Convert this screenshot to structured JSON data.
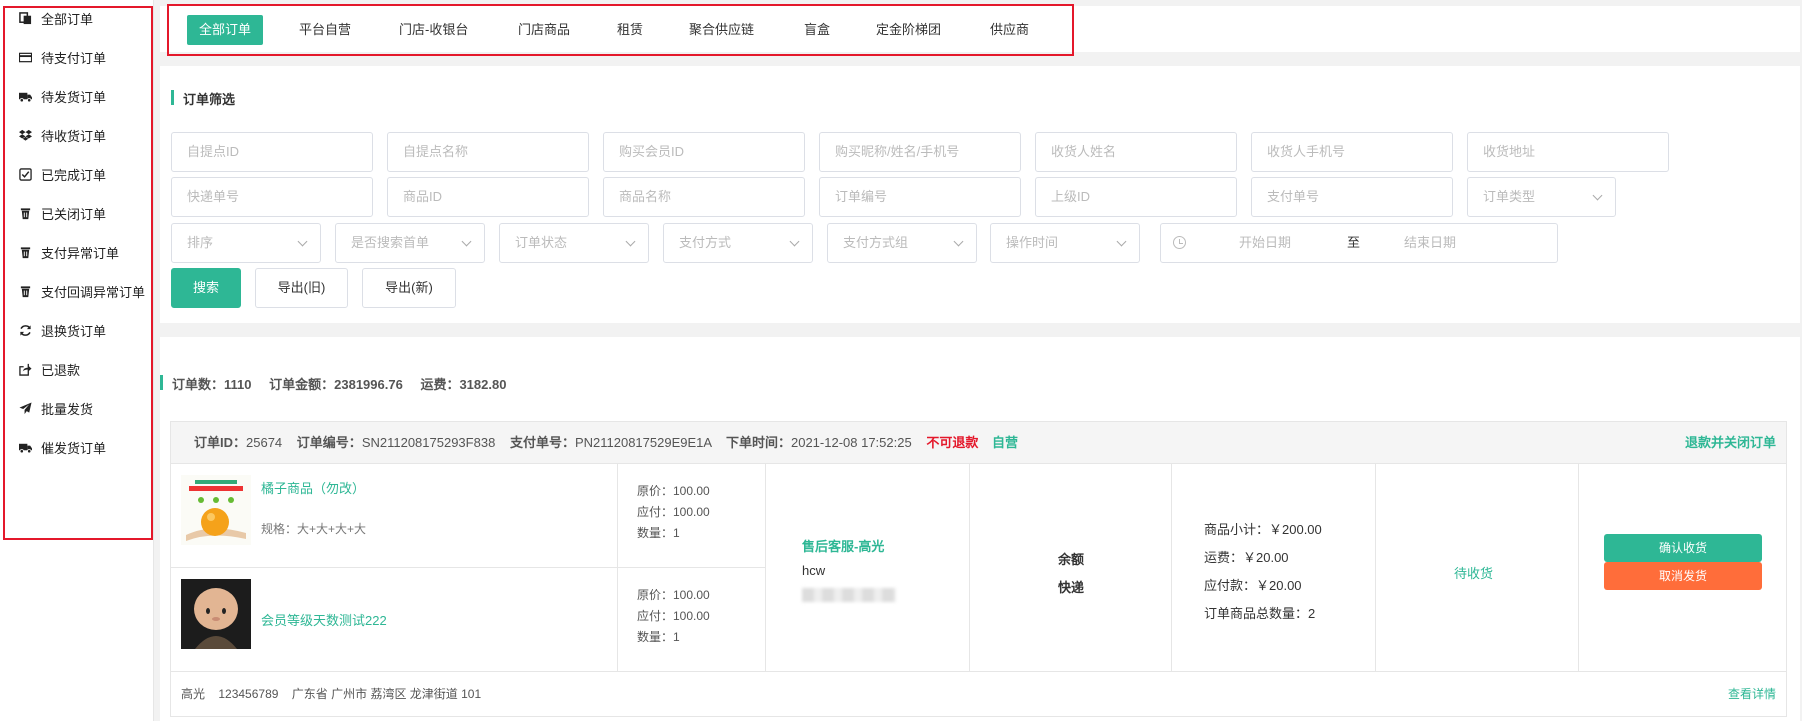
{
  "sidebar": {
    "items": [
      {
        "label": "全部订单",
        "icon": "copy-icon"
      },
      {
        "label": "待支付订单",
        "icon": "credit-card-icon"
      },
      {
        "label": "待发货订单",
        "icon": "truck-icon"
      },
      {
        "label": "待收货订单",
        "icon": "dropbox-icon"
      },
      {
        "label": "已完成订单",
        "icon": "check-square-icon"
      },
      {
        "label": "已关闭订单",
        "icon": "trash-icon"
      },
      {
        "label": "支付异常订单",
        "icon": "trash-icon"
      },
      {
        "label": "支付回调异常订单",
        "icon": "trash-icon"
      },
      {
        "label": "退换货订单",
        "icon": "refresh-icon"
      },
      {
        "label": "已退款",
        "icon": "share-icon"
      },
      {
        "label": "批量发货",
        "icon": "paper-plane-icon"
      },
      {
        "label": "催发货订单",
        "icon": "truck-icon"
      }
    ]
  },
  "tabs": [
    "全部订单",
    "平台自营",
    "门店-收银台",
    "门店商品",
    "租赁",
    "聚合供应链",
    "盲盒",
    "定金阶梯团",
    "供应商"
  ],
  "filter": {
    "title": "订单筛选",
    "row1": [
      "自提点ID",
      "自提点名称",
      "购买会员ID",
      "购买昵称/姓名/手机号",
      "收货人姓名",
      "收货人手机号",
      "收货地址"
    ],
    "row2": [
      "快递单号",
      "商品ID",
      "商品名称",
      "订单编号",
      "上级ID",
      "支付单号"
    ],
    "order_type": "订单类型",
    "row3": [
      "排序",
      "是否搜索首单",
      "订单状态",
      "支付方式",
      "支付方式组",
      "操作时间"
    ],
    "date_start": "开始日期",
    "date_sep": "至",
    "date_end": "结束日期",
    "search_btn": "搜索",
    "export_old": "导出(旧)",
    "export_new": "导出(新)"
  },
  "stats": {
    "count": "订单数：1110",
    "amount": "订单金额：2381996.76",
    "freight": "运费：3182.80"
  },
  "order": {
    "id_label": "订单ID：",
    "id": "25674",
    "no_label": "订单编号：",
    "no": "SN211208175293F838",
    "pay_label": "支付单号：",
    "pay_no": "PN21120817529E9E1A",
    "time_label": "下单时间：",
    "time": "2021-12-08 17:52:25",
    "refund_flag": "不可退款",
    "self_flag": "自营",
    "close_action": "退款并关闭订单",
    "products": [
      {
        "name": "橘子商品（勿改）",
        "spec": "规格：大+大+大+大",
        "orig": "原价：100.00",
        "pay": "应付：100.00",
        "qty": "数量：1"
      },
      {
        "name": "会员等级天数测试222",
        "spec": "",
        "orig": "原价：100.00",
        "pay": "应付：100.00",
        "qty": "数量：1"
      }
    ],
    "service": "售后客服-高光",
    "buyer": "hcw",
    "pay_method": "余额",
    "delivery": "快递",
    "subtotal": "商品小计：￥200.00",
    "freight": "运费：￥20.00",
    "payable": "应付款：￥20.00",
    "total_qty": "订单商品总数量：2",
    "status": "待收货",
    "confirm_btn": "确认收货",
    "cancel_btn": "取消发货",
    "addr_name": "高光",
    "addr_phone": "123456789",
    "addr": "广东省 广州市 荔湾区 龙津街道 101",
    "detail_link": "查看详情"
  },
  "colors": {
    "accent": "#2eb795",
    "danger": "#e4182b",
    "warn": "#ff6d3a"
  }
}
